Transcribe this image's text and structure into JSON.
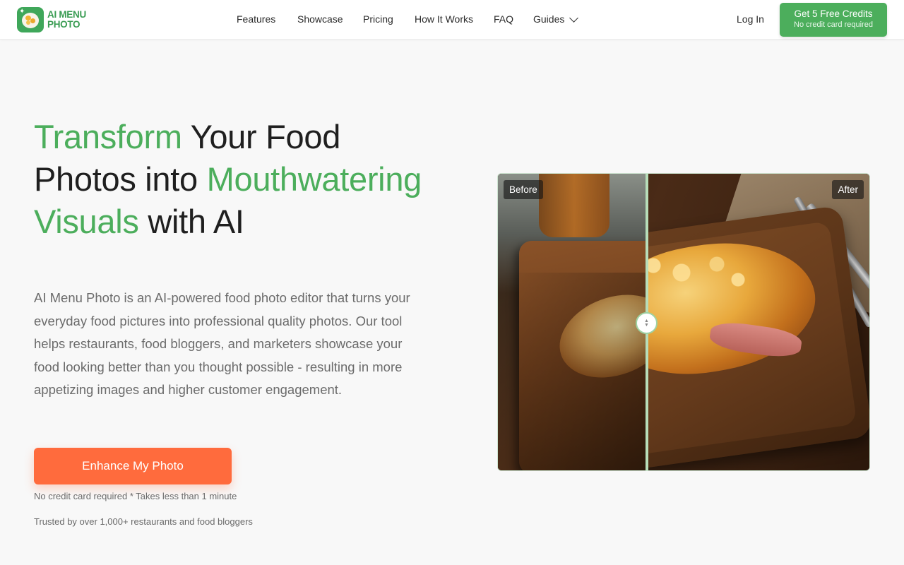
{
  "brand": {
    "line1": "AI MENU",
    "line2": "PHOTO"
  },
  "nav": {
    "items": [
      "Features",
      "Showcase",
      "Pricing",
      "How It Works",
      "FAQ"
    ],
    "guides": "Guides",
    "login": "Log In",
    "cta": {
      "label": "Get 5 Free Credits",
      "sub": "No credit card required"
    }
  },
  "hero": {
    "title_parts": [
      "Transform",
      " Your Food Photos into ",
      "Mouthwatering Visuals",
      " with AI"
    ],
    "description": "AI Menu Photo is an AI-powered food photo editor that turns your everyday food pictures into professional quality photos. Our tool helps restaurants, food bloggers, and marketers showcase your food looking better than you thought possible - resulting in more appetizing images and higher customer engagement.",
    "button": "Enhance My Photo",
    "note": "No credit card required * Takes less than 1 minute",
    "trust": "Trusted by over 1,000+ restaurants and food bloggers"
  },
  "comparison": {
    "before_label": "Before",
    "after_label": "After",
    "slider_position": 0.4
  },
  "colors": {
    "accent_green": "#4cae5c",
    "cta_orange": "#ff6b3d",
    "text_dark": "#1f1f1f",
    "text_muted": "#6b6b6b"
  }
}
